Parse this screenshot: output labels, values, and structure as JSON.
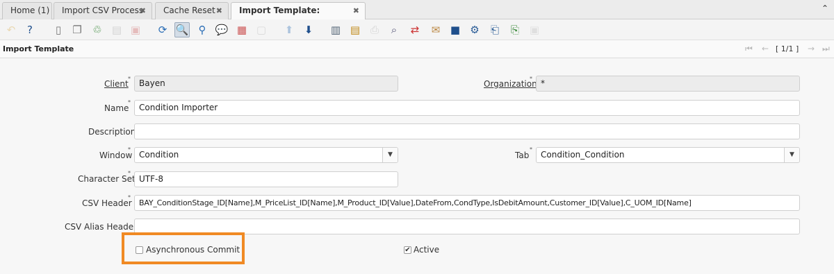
{
  "tabs": [
    {
      "label": "Home (1)",
      "closable": false
    },
    {
      "label": "Import CSV Process",
      "closable": true
    },
    {
      "label": "Cache Reset",
      "closable": true
    },
    {
      "label": "Import Template: Condition ...",
      "closable": true,
      "active": true
    }
  ],
  "tab_close_glyph": "✖",
  "collapse_glyph": "⌃",
  "toolbar_icons": [
    {
      "name": "undo-icon",
      "glyph": "↶",
      "color": "#d9a63b",
      "disabled": true
    },
    {
      "name": "help-icon",
      "glyph": "?",
      "color": "#1f4f8c"
    },
    {
      "name": "new-record-icon",
      "glyph": "▯",
      "color": "#777"
    },
    {
      "name": "copy-record-icon",
      "glyph": "❐",
      "color": "#777"
    },
    {
      "name": "delete-record-icon",
      "glyph": "♲",
      "color": "#3a8a3a"
    },
    {
      "name": "save-icon",
      "glyph": "▤",
      "color": "#999",
      "disabled": true
    },
    {
      "name": "save-new-icon",
      "glyph": "▣",
      "color": "#c55",
      "disabled": true
    },
    {
      "name": "refresh-icon",
      "glyph": "⟳",
      "color": "#2a6db5"
    },
    {
      "name": "find-icon",
      "glyph": "🔍",
      "color": "#2a5c96",
      "pressed": true
    },
    {
      "name": "attachment-icon",
      "glyph": "⚲",
      "color": "#2a6db5"
    },
    {
      "name": "chat-icon",
      "glyph": "💬",
      "color": "#666"
    },
    {
      "name": "grid-toggle-icon",
      "glyph": "▦",
      "color": "#c55"
    },
    {
      "name": "multi-select-icon",
      "glyph": "▢",
      "color": "#aaa",
      "disabled": true
    },
    {
      "name": "previous-record-icon",
      "glyph": "⬆",
      "color": "#2a6db5",
      "disabled": true
    },
    {
      "name": "next-record-icon",
      "glyph": "⬇",
      "color": "#1f4f8c"
    },
    {
      "name": "detail-record-icon",
      "glyph": "▥",
      "color": "#567"
    },
    {
      "name": "report-icon",
      "glyph": "▤",
      "color": "#c08a1a"
    },
    {
      "name": "print-icon",
      "glyph": "⎙",
      "color": "#999",
      "disabled": true
    },
    {
      "name": "zoom-across-icon",
      "glyph": "⌕",
      "color": "#557"
    },
    {
      "name": "workflow-icon",
      "glyph": "⇄",
      "color": "#c33"
    },
    {
      "name": "archive-icon",
      "glyph": "✉",
      "color": "#b84"
    },
    {
      "name": "product-info-icon",
      "glyph": "■",
      "color": "#1f4f8c"
    },
    {
      "name": "process-icon",
      "glyph": "⚙",
      "color": "#2a5c96"
    },
    {
      "name": "export-icon",
      "glyph": "⎗",
      "color": "#2a5c96"
    },
    {
      "name": "import-icon",
      "glyph": "⎘",
      "color": "#3a8a3a"
    },
    {
      "name": "lock-icon",
      "glyph": "▣",
      "color": "#bbb",
      "disabled": true
    }
  ],
  "window": {
    "title": "Import Template"
  },
  "record_nav": {
    "first": "⏮",
    "prev": "←",
    "position": "[ 1/1 ]",
    "next": "→",
    "last": "⏭"
  },
  "form": {
    "client": {
      "label": "Client",
      "value": "Bayen"
    },
    "organization": {
      "label": "Organization",
      "value": "*"
    },
    "name": {
      "label": "Name",
      "value": "Condition Importer"
    },
    "description": {
      "label": "Description",
      "value": ""
    },
    "window": {
      "label": "Window",
      "value": "Condition"
    },
    "tab": {
      "label": "Tab",
      "value": "Condition_Condition"
    },
    "character_set": {
      "label": "Character Set",
      "value": "UTF-8"
    },
    "csv_header": {
      "label": "CSV Header",
      "value": "BAY_ConditionStage_ID[Name],M_PriceList_ID[Name],M_Product_ID[Value],DateFrom,CondType,IsDebitAmount,Customer_ID[Value],C_UOM_ID[Name]"
    },
    "csv_alias_header": {
      "label": "CSV Alias Header",
      "value": ""
    },
    "asynchronous_commit": {
      "label": "Asynchronous Commit",
      "checked": false
    },
    "active": {
      "label": "Active",
      "checked": true
    }
  },
  "required_marker": "*",
  "dropdown_glyph": "▼",
  "check_glyph": "✔",
  "highlight_color": "#f08a24"
}
